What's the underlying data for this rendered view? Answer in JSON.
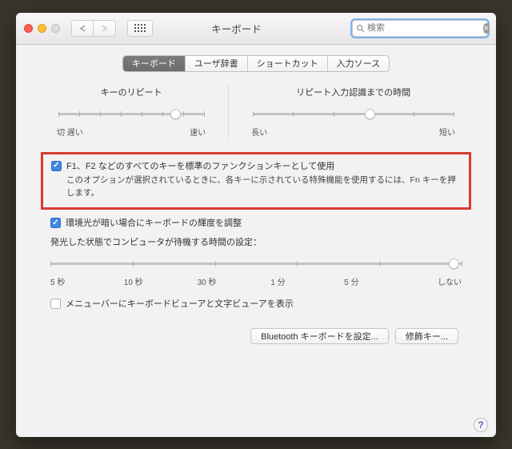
{
  "window": {
    "title": "キーボード"
  },
  "search": {
    "placeholder": "検索"
  },
  "tabs": [
    "キーボード",
    "ユーザ辞書",
    "ショートカット",
    "入力ソース"
  ],
  "sliders": {
    "repeat": {
      "title": "キーのリピート",
      "left": "切 遅い",
      "right": "速い",
      "position": 80,
      "ticks": 8
    },
    "delay": {
      "title": "リピート入力認識までの時間",
      "left": "長い",
      "right": "短い",
      "position": 58,
      "ticks": 6
    }
  },
  "fn": {
    "label": "F1、F2 などのすべてのキーを標準のファンクションキーとして使用",
    "hint": "このオプションが選択されているときに、各キーに示されている特殊機能を使用するには、Fn キーを押します。"
  },
  "backlight": {
    "label": "環境光が暗い場合にキーボードの輝度を調整",
    "dimTitle": "発光した状態でコンピュータが待機する時間の設定：",
    "labels": [
      "5 秒",
      "10 秒",
      "30 秒",
      "1 分",
      "5 分",
      "しない"
    ],
    "position": 98
  },
  "viewer": {
    "label": "メニューバーにキーボードビューアと文字ビューアを表示"
  },
  "buttons": {
    "bt": "Bluetooth キーボードを設定...",
    "mod": "修飾キー..."
  }
}
